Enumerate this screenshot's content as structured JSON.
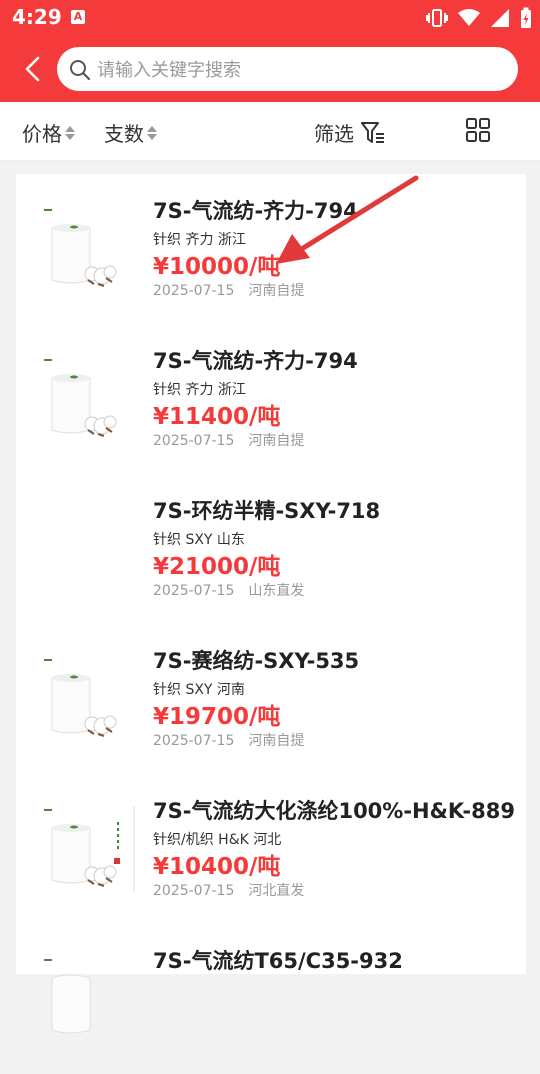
{
  "status": {
    "time": "4:29"
  },
  "search": {
    "placeholder": "请输入关键字搜索"
  },
  "sort": {
    "price": "价格",
    "count": "支数",
    "filter": "筛选"
  },
  "items": [
    {
      "title": "7S-气流纺-齐力-794",
      "meta": "针织 齐力 浙江",
      "price": "¥10000/吨",
      "date": "2025-07-15",
      "place": "河南自提"
    },
    {
      "title": "7S-气流纺-齐力-794",
      "meta": "针织 齐力 浙江",
      "price": "¥11400/吨",
      "date": "2025-07-15",
      "place": "河南自提"
    },
    {
      "title": "7S-环纺半精-SXY-718",
      "meta": "针织 SXY 山东",
      "price": "¥21000/吨",
      "date": "2025-07-15",
      "place": "山东直发"
    },
    {
      "title": "7S-赛络纺-SXY-535",
      "meta": "针织 SXY 河南",
      "price": "¥19700/吨",
      "date": "2025-07-15",
      "place": "河南自提"
    },
    {
      "title": "7S-气流纺大化涤纶100%-H&K-889",
      "meta": "针织/机织 H&K 河北",
      "price": "¥10400/吨",
      "date": "2025-07-15",
      "place": "河北直发"
    },
    {
      "title": "7S-气流纺T65/C35-932",
      "meta": "",
      "price": "",
      "date": "",
      "place": ""
    }
  ]
}
